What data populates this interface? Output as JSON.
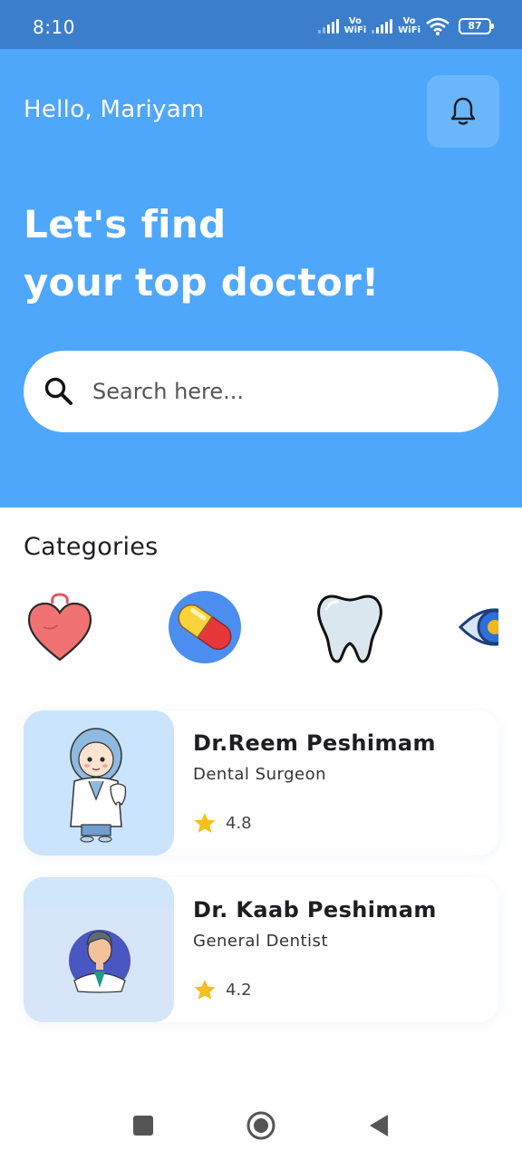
{
  "status_bar": {
    "time": "8:10",
    "vowifi_top": "Vo",
    "vowifi_bottom": "WiFi",
    "battery": "87"
  },
  "header": {
    "greeting": "Hello, Mariyam",
    "headline_line1": "Let's find",
    "headline_line2": "your top doctor!",
    "search_placeholder": "Search here...",
    "bell_icon": "bell-icon",
    "background_color": "#4EA7FB"
  },
  "categories": {
    "title": "Categories",
    "items": [
      {
        "icon": "heart-icon"
      },
      {
        "icon": "pill-icon"
      },
      {
        "icon": "tooth-icon"
      },
      {
        "icon": "eye-icon"
      }
    ]
  },
  "doctors": [
    {
      "name": "Dr.Reem Peshimam",
      "specialty": "Dental Surgeon",
      "rating": "4.8"
    },
    {
      "name": "Dr. Kaab Peshimam",
      "specialty": "General Dentist",
      "rating": "4.2"
    }
  ],
  "colors": {
    "star": "#F5C01C",
    "accent": "#4EA7FB"
  }
}
